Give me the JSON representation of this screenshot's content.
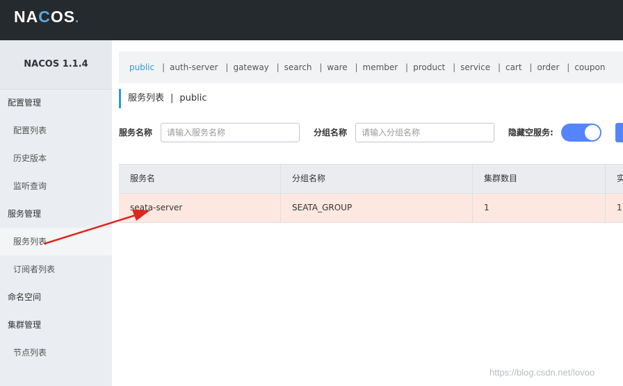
{
  "header": {
    "logo": {
      "part1": "NA",
      "part2": "C",
      "part3": "OS",
      "dot": "."
    }
  },
  "sidebar": {
    "version": "NACOS 1.1.4",
    "items": [
      {
        "label": "配置管理",
        "type": "group"
      },
      {
        "label": "配置列表",
        "type": "sub"
      },
      {
        "label": "历史版本",
        "type": "sub"
      },
      {
        "label": "监听查询",
        "type": "sub"
      },
      {
        "label": "服务管理",
        "type": "group"
      },
      {
        "label": "服务列表",
        "type": "sub",
        "active": true
      },
      {
        "label": "订阅者列表",
        "type": "sub"
      },
      {
        "label": "命名空间",
        "type": "group"
      },
      {
        "label": "集群管理",
        "type": "group"
      },
      {
        "label": "节点列表",
        "type": "sub"
      }
    ]
  },
  "namespaces": {
    "items": [
      "public",
      "auth-server",
      "gateway",
      "search",
      "ware",
      "member",
      "product",
      "service",
      "cart",
      "order",
      "coupon"
    ],
    "active": "public",
    "separator": "|"
  },
  "page": {
    "title": "服务列表",
    "separator": "|",
    "namespace": "public"
  },
  "filters": {
    "service_name_label": "服务名称",
    "service_name_placeholder": "请输入服务名称",
    "group_name_label": "分组名称",
    "group_name_placeholder": "请输入分组名称",
    "hide_empty_label": "隐藏空服务:",
    "hide_empty_on": true
  },
  "table": {
    "headers": [
      "服务名",
      "分组名称",
      "集群数目",
      "实"
    ],
    "rows": [
      [
        "seata-server",
        "SEATA_GROUP",
        "1",
        "1"
      ]
    ]
  },
  "watermark": "https://blog.csdn.net/lovoo",
  "colors": {
    "topbar": "#252a2f",
    "accent": "#2c9bd5",
    "toggle": "#5584ff",
    "highlight_row": "#fde8e1",
    "arrow": "#e0261d"
  }
}
